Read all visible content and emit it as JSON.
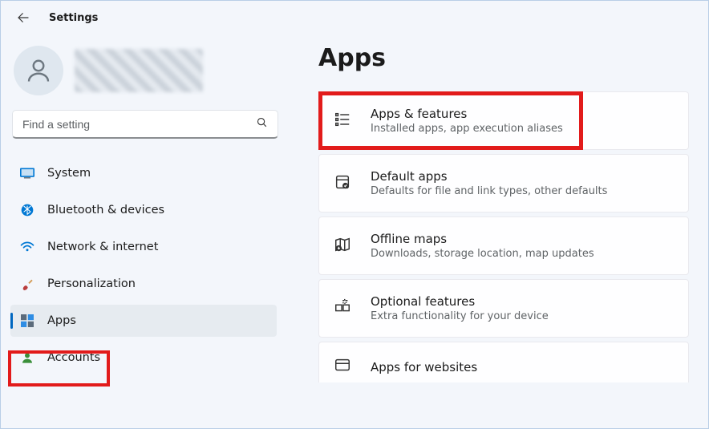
{
  "titlebar": {
    "app_title": "Settings"
  },
  "search": {
    "placeholder": "Find a setting"
  },
  "nav": {
    "items": [
      {
        "label": "System"
      },
      {
        "label": "Bluetooth & devices"
      },
      {
        "label": "Network & internet"
      },
      {
        "label": "Personalization"
      },
      {
        "label": "Apps"
      },
      {
        "label": "Accounts"
      }
    ]
  },
  "page": {
    "title": "Apps",
    "cards": [
      {
        "title": "Apps & features",
        "sub": "Installed apps, app execution aliases"
      },
      {
        "title": "Default apps",
        "sub": "Defaults for file and link types, other defaults"
      },
      {
        "title": "Offline maps",
        "sub": "Downloads, storage location, map updates"
      },
      {
        "title": "Optional features",
        "sub": "Extra functionality for your device"
      },
      {
        "title": "Apps for websites",
        "sub": ""
      }
    ]
  }
}
